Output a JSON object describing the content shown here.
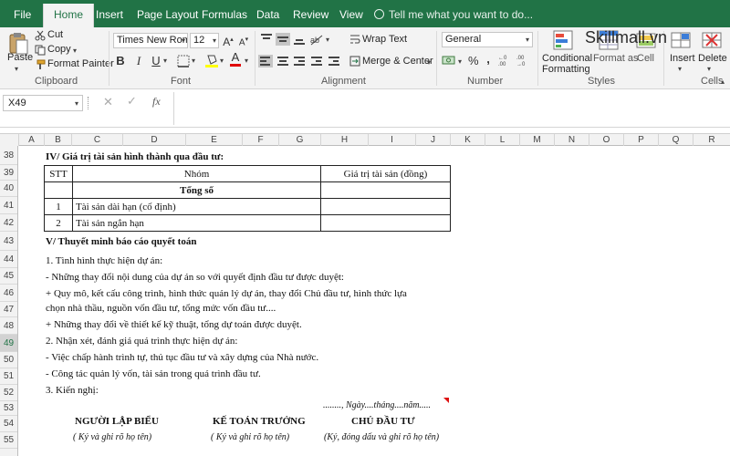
{
  "tabs": [
    "File",
    "Home",
    "Insert",
    "Page Layout",
    "Formulas",
    "Data",
    "Review",
    "View"
  ],
  "tell_me": "Tell me what you want to do...",
  "watermark": "Skillmall.vn",
  "clipboard": {
    "paste": "Paste",
    "cut": "Cut",
    "copy": "Copy",
    "format_painter": "Format Painter",
    "label": "Clipboard"
  },
  "font": {
    "name": "Times New Roma",
    "size": "12",
    "label": "Font"
  },
  "alignment": {
    "wrap": "Wrap Text",
    "merge": "Merge & Center",
    "label": "Alignment"
  },
  "number": {
    "format": "General",
    "percent": "%",
    "comma": ",",
    "label": "Number"
  },
  "styles": {
    "conditional_1": "Conditional",
    "conditional_2": "Formatting",
    "format_as": "Format as",
    "cell_styles": "Cell",
    "label": "Styles"
  },
  "cells": {
    "insert": "Insert",
    "delete": "Delete",
    "label": "Cells"
  },
  "formula_bar": {
    "name_box": "X49",
    "fx": "fx",
    "value": ""
  },
  "columns": [
    "A",
    "B",
    "C",
    "D",
    "E",
    "F",
    "G",
    "H",
    "I",
    "J",
    "K",
    "L",
    "M",
    "N",
    "O",
    "P",
    "Q",
    "R"
  ],
  "rows": [
    "38",
    "39",
    "40",
    "41",
    "42",
    "43",
    "44",
    "45",
    "46",
    "47",
    "48",
    "49",
    "50",
    "51",
    "52",
    "53",
    "54",
    "55"
  ],
  "selected_row": "49",
  "sheet": {
    "section4": "IV/ Giá trị tài sản hình thành qua đầu tư:",
    "table": {
      "h_stt": "STT",
      "h_nhom": "Nhóm",
      "h_value": "Giá trị tài sản (đồng)",
      "total": "Tổng số",
      "r1_stt": "1",
      "r1_name": "Tài sản dài hạn (cố định)",
      "r2_stt": "2",
      "r2_name": "Tài sản ngắn hạn"
    },
    "section5": "V/ Thuyết minh báo cáo quyết toán",
    "l45": "1. Tình hình thực hiện dự án:",
    "l46": " - Những thay đổi nội dung của dự án so với quyết định đầu tư được duyệt:",
    "l47": " + Quy mô, kết cấu công trình, hình thức quản lý dự án, thay đổi Chủ đầu tư, hình thức lựa",
    "l47b": "chọn nhà thầu, nguồn vốn đầu tư, tổng mức vốn đầu tư....",
    "l48": " + Những thay đổi về thiết kế kỹ thuật, tổng dự toán được duyệt.",
    "l49": "2. Nhận xét, đánh giá quá trình thực hiện dự án:",
    "l50": " - Việc chấp hành trình tự, thủ tục đầu tư và xây dựng của Nhà nước.",
    "l51": " - Công tác quản lý vốn, tài sản trong quá trình đầu tư.",
    "l52": "3. Kiến nghị:",
    "date": "........, Ngày....tháng....năm.....",
    "sig1": "NGƯỜI LẬP BIỂU",
    "sig2": "KẾ TOÁN TRƯỞNG",
    "sig3": "CHỦ ĐẦU TƯ",
    "sig1_note": "( Ký và ghi rõ họ tên)",
    "sig2_note": "( Ký và ghi rõ họ tên)",
    "sig3_note": "(Ký, đóng dấu và ghi rõ họ tên)"
  },
  "colors": {
    "accent": "#217346",
    "ribbon": "#f3f3f3"
  }
}
